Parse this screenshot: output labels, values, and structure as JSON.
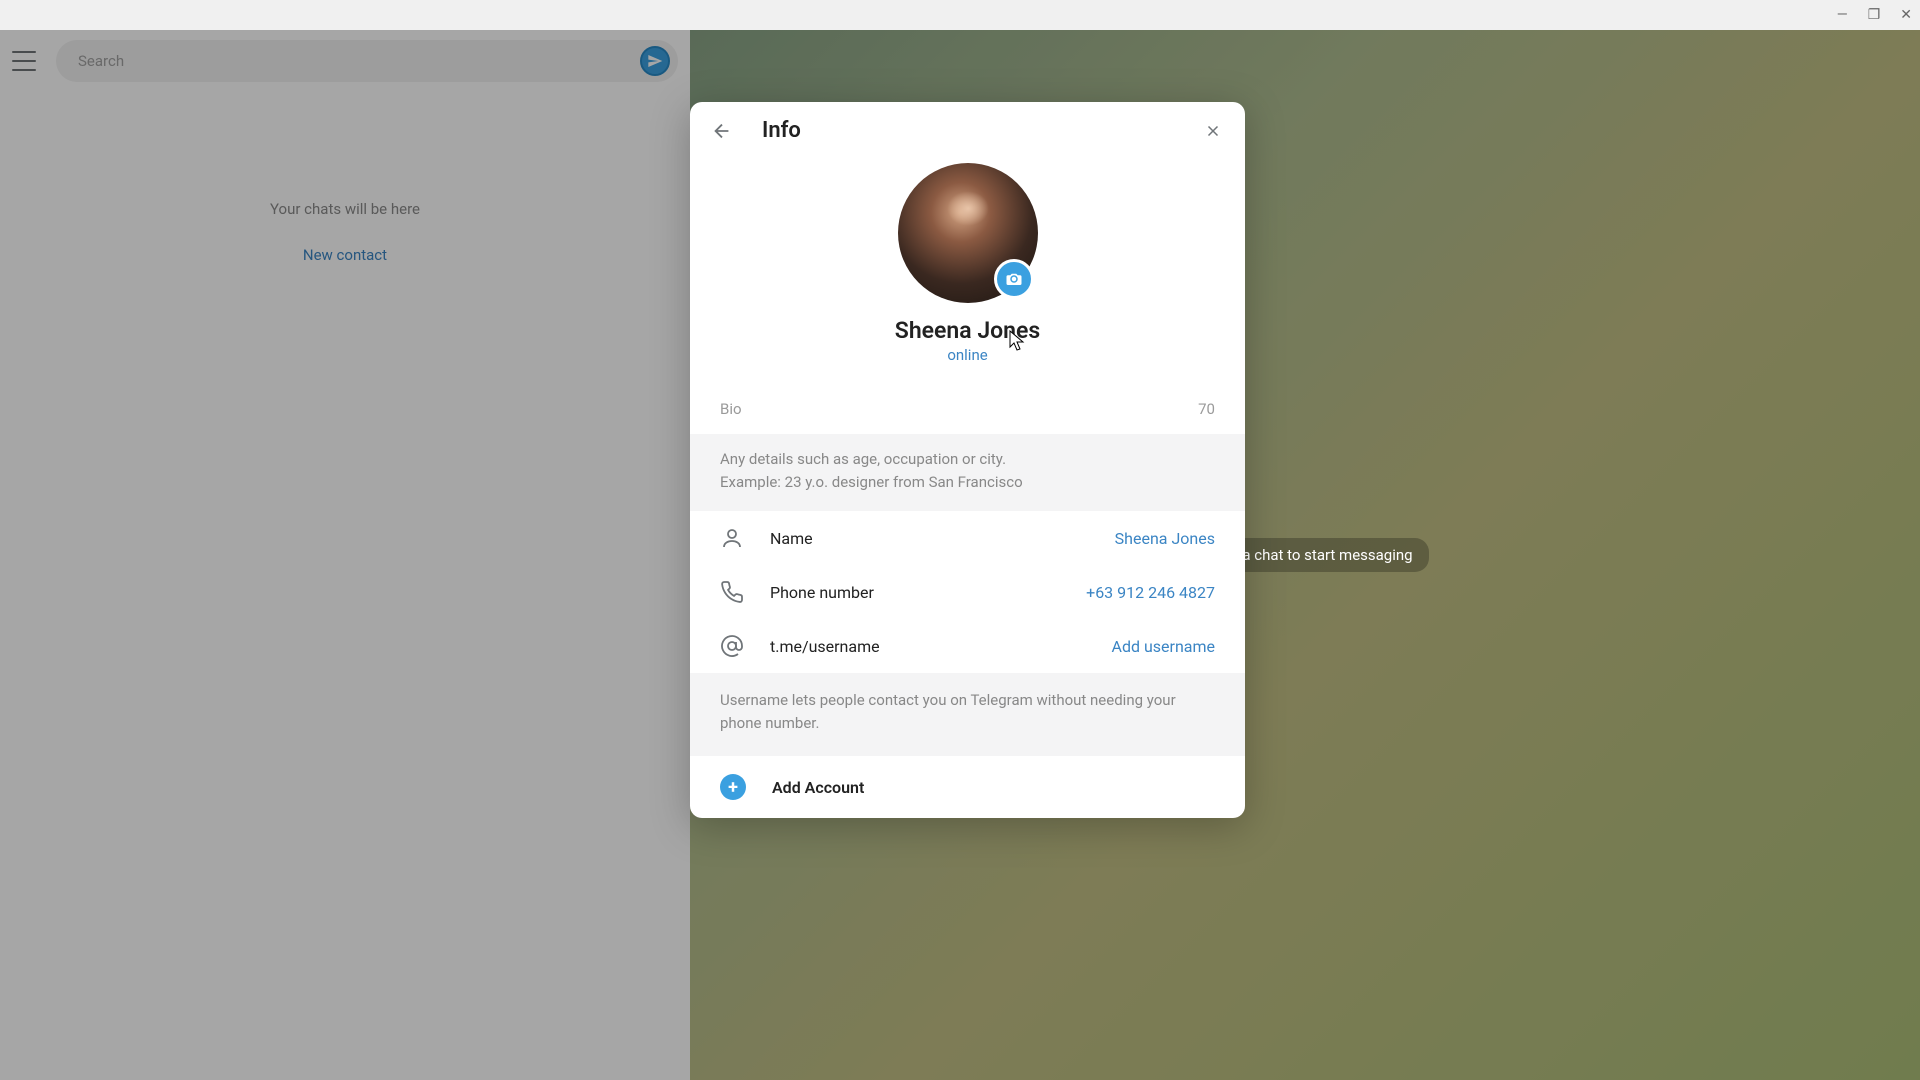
{
  "titlebar": {
    "minimize": "—",
    "maximize": "❐",
    "close": "✕"
  },
  "sidebar": {
    "search_placeholder": "Search",
    "chats_message": "Your chats will be here",
    "new_contact": "New contact"
  },
  "main": {
    "chat_hint": "Select a chat to start messaging"
  },
  "modal": {
    "title": "Info",
    "profile": {
      "name": "Sheena Jones",
      "status": "online"
    },
    "bio": {
      "label": "Bio",
      "count": "70",
      "hint_line1": "Any details such as age, occupation or city.",
      "hint_line2": "Example: 23 y.o. designer from San Francisco"
    },
    "rows": {
      "name": {
        "label": "Name",
        "value": "Sheena Jones"
      },
      "phone": {
        "label": "Phone number",
        "value": "+63 912 246 4827"
      },
      "username": {
        "label": "t.me/username",
        "value": "Add username"
      }
    },
    "username_hint": "Username lets people contact you on Telegram without needing your phone number.",
    "add_account": "Add Account"
  }
}
